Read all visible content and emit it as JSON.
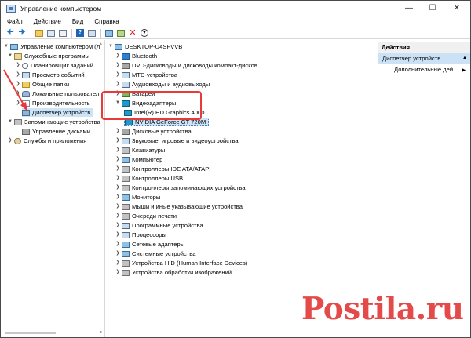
{
  "window": {
    "title": "Управление компьютером"
  },
  "menu": [
    "Файл",
    "Действие",
    "Вид",
    "Справка"
  ],
  "left_tree": {
    "root": "Управление компьютером (л",
    "utilities": "Служебные программы",
    "task_scheduler": "Планировщик заданий",
    "event_viewer": "Просмотр событий",
    "shared_folders": "Общие папки",
    "local_users": "Локальные пользовател",
    "performance": "Производительность",
    "device_manager": "Диспетчер устройств",
    "storage": "Запоминающие устройства",
    "disk_management": "Управление дисками",
    "services": "Службы и приложения"
  },
  "device_tree": {
    "computer": "DESKTOP-U4SFVVB",
    "categories": [
      "Bluetooth",
      "DVD-дисководы и дисководы компакт-дисков",
      "MTD-устройства",
      "Аудиовходы и аудиовыходы",
      "Батареи",
      "Видеоадаптеры",
      "Intel(R) HD Graphics 4000",
      "NVIDIA GeForce GT 720M",
      "Дисковые устройства",
      "Звуковые, игровые и видеоустройства",
      "Клавиатуры",
      "Компьютер",
      "Контроллеры IDE ATA/ATAPI",
      "Контроллеры USB",
      "Контроллеры запоминающих устройства",
      "Мониторы",
      "Мыши и иные указывающие устройства",
      "Очереди печати",
      "Программные устройства",
      "Процессоры",
      "Сетевые адаптеры",
      "Системные устройства",
      "Устройства HID (Human Interface Devices)",
      "Устройства обработки изображений"
    ]
  },
  "actions": {
    "header": "Действия",
    "section": "Диспетчер устройств",
    "more": "Дополнительные дей..."
  },
  "watermark": "Postila.ru",
  "colors": {
    "selection": "#cde4f7",
    "highlight_box": "#e83a3a",
    "watermark": "#e23b3b"
  }
}
